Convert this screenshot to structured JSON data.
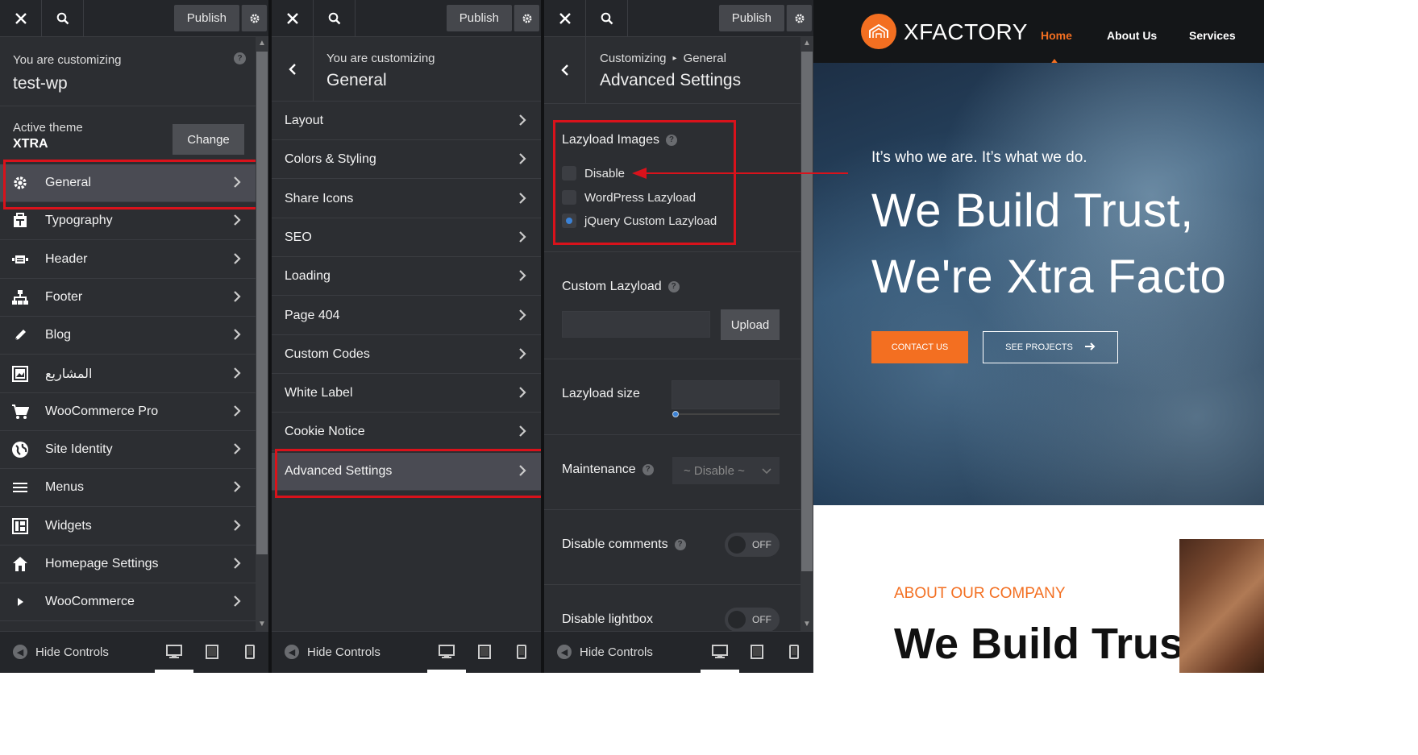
{
  "panels": {
    "root": {
      "publish": "Publish",
      "customizing_label": "You are customizing",
      "site_name": "test-wp",
      "theme_label": "Active theme",
      "theme_name": "XTRA",
      "change_button": "Change",
      "items": [
        {
          "label": "General",
          "icon": "gear-icon"
        },
        {
          "label": "Typography",
          "icon": "typography-icon"
        },
        {
          "label": "Header",
          "icon": "header-icon"
        },
        {
          "label": "Footer",
          "icon": "sitemap-icon"
        },
        {
          "label": "Blog",
          "icon": "pencil-icon"
        },
        {
          "label": "المشاريع",
          "icon": "portfolio-icon"
        },
        {
          "label": "WooCommerce Pro",
          "icon": "cart-icon"
        },
        {
          "label": "Site Identity",
          "icon": "globe-icon"
        },
        {
          "label": "Menus",
          "icon": "menu-icon"
        },
        {
          "label": "Widgets",
          "icon": "widgets-icon"
        },
        {
          "label": "Homepage Settings",
          "icon": "home-icon"
        },
        {
          "label": "WooCommerce",
          "icon": "triangle-right-icon"
        }
      ],
      "hide_controls": "Hide Controls"
    },
    "general": {
      "publish": "Publish",
      "customizing_label": "You are customizing",
      "title": "General",
      "items": [
        {
          "label": "Layout"
        },
        {
          "label": "Colors & Styling"
        },
        {
          "label": "Share Icons"
        },
        {
          "label": "SEO"
        },
        {
          "label": "Loading"
        },
        {
          "label": "Page 404"
        },
        {
          "label": "Custom Codes"
        },
        {
          "label": "White Label"
        },
        {
          "label": "Cookie Notice"
        },
        {
          "label": "Advanced Settings"
        }
      ],
      "hide_controls": "Hide Controls"
    },
    "advanced": {
      "publish": "Publish",
      "breadcrumb_root": "Customizing",
      "breadcrumb_sep": "▸",
      "breadcrumb_parent": "General",
      "title": "Advanced Settings",
      "lazyload_title": "Lazyload Images",
      "lazyload_options": [
        "Disable",
        "WordPress Lazyload",
        "jQuery Custom Lazyload"
      ],
      "lazyload_selected": "jQuery Custom Lazyload",
      "custom_lazyload_title": "Custom Lazyload",
      "upload_button": "Upload",
      "lazyload_size_title": "Lazyload size",
      "maintenance_title": "Maintenance",
      "maintenance_value": "~ Disable ~",
      "disable_comments_title": "Disable comments",
      "disable_comments_value": "OFF",
      "disable_lightbox_title": "Disable lightbox",
      "disable_lightbox_value": "OFF",
      "hide_controls": "Hide Controls"
    }
  },
  "preview": {
    "logo": "XFACTORY",
    "nav": [
      "Home",
      "About Us",
      "Services"
    ],
    "tagline": "It’s who we are. It’s what we do.",
    "headline_1": "We Build Trust,",
    "headline_2": "We're Xtra Facto",
    "contact_button": "CONTACT US",
    "projects_button": "SEE PROJECTS",
    "about_label": "ABOUT OUR COMPANY",
    "about_heading": "We Build Trust"
  },
  "colors": {
    "panel_bg": "#2c2e32",
    "selected_bg": "#4a4b53",
    "highlight": "#d9121b",
    "accent_orange": "#f36f21",
    "radio_blue": "#3b82d6"
  }
}
